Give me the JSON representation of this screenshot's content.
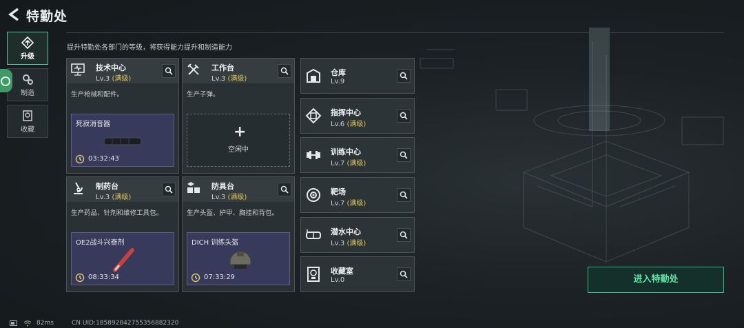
{
  "header": {
    "title": "特勤处",
    "subtitle": "提升特勤处各部门的等级，将获得能力提升和制造能力"
  },
  "sidebar": {
    "tabs": [
      {
        "label": "升级",
        "icon": "upgrade-icon"
      },
      {
        "label": "制造",
        "icon": "gears-icon"
      },
      {
        "label": "收藏",
        "icon": "collection-icon"
      }
    ]
  },
  "departments": {
    "tech": {
      "name": "技术中心",
      "level": "Lv.3",
      "max": "(满级)",
      "desc": "生产枪械和配件。",
      "product": "死寂消音器",
      "time": "03:32:43",
      "icon": "monitor-icon"
    },
    "workbench": {
      "name": "工作台",
      "level": "Lv.3",
      "max": "(满级)",
      "desc": "生产子弹。",
      "empty_label": "空闲中",
      "plus": "+",
      "icon": "tools-icon"
    },
    "pharmacy": {
      "name": "制药台",
      "level": "Lv.3",
      "max": "(满级)",
      "desc": "生产药品、针剂和维修工具包。",
      "product": "OE2战斗兴奋剂",
      "time": "08:33:34",
      "icon": "microscope-icon"
    },
    "armor": {
      "name": "防具台",
      "level": "Lv.3",
      "max": "(满级)",
      "desc": "生产头盔、护甲、胸挂和背包。",
      "product": "DICH 训练头盔",
      "time": "07:33:29",
      "icon": "armor-boxes-icon"
    },
    "storage": {
      "name": "仓库",
      "level": "Lv.9",
      "max": "",
      "icon": "warehouse-icon"
    },
    "command": {
      "name": "指挥中心",
      "level": "Lv.6",
      "max": "(满级)",
      "icon": "chip-icon"
    },
    "training": {
      "name": "训练中心",
      "level": "Lv.7",
      "max": "(满级)",
      "icon": "dumbbell-icon"
    },
    "range": {
      "name": "靶场",
      "level": "Lv.7",
      "max": "(满级)",
      "icon": "target-icon"
    },
    "diving": {
      "name": "潜水中心",
      "level": "Lv.3",
      "max": "(满级)",
      "icon": "goggles-icon"
    },
    "collection": {
      "name": "收藏室",
      "level": "Lv.0",
      "max": "",
      "icon": "trophy-icon"
    }
  },
  "enter_button": "进入特勤处",
  "status": {
    "ping": "82ms",
    "uid": "CN UID:18589284275535688​2320"
  },
  "colors": {
    "accent": "#3bb883",
    "max_level": "#e0c45e",
    "product_bg": "#373a5a"
  }
}
